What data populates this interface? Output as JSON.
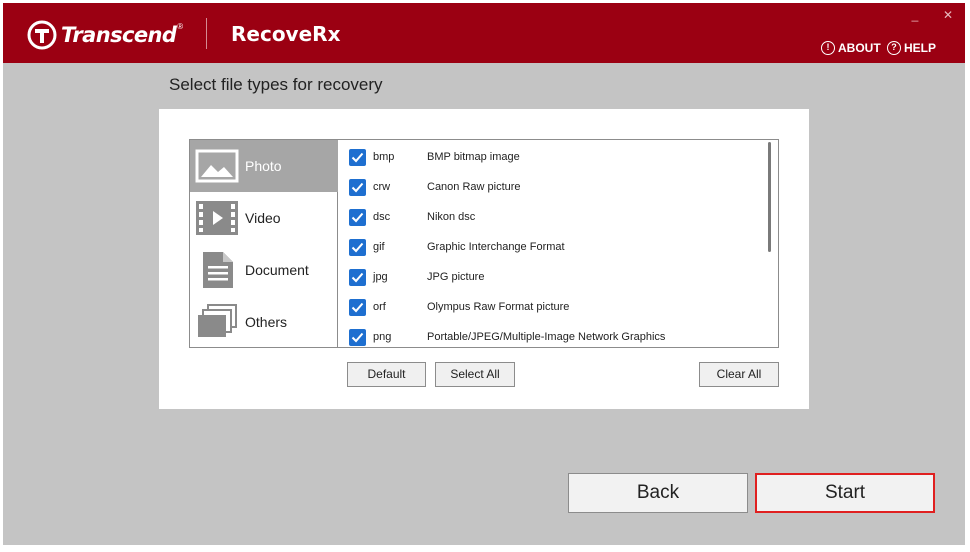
{
  "titlebar": {
    "brand": "Transcend",
    "brand_mark": "®",
    "app_name": "RecoveRx",
    "minimize_glyph": "_",
    "close_glyph": "✕",
    "about_label": "ABOUT",
    "help_label": "HELP",
    "background_color": "#9b0012"
  },
  "main": {
    "heading": "Select file types for recovery"
  },
  "categories": [
    {
      "label": "Photo",
      "icon": "photo-icon",
      "active": true
    },
    {
      "label": "Video",
      "icon": "video-icon",
      "active": false
    },
    {
      "label": "Document",
      "icon": "document-icon",
      "active": false
    },
    {
      "label": "Others",
      "icon": "others-icon",
      "active": false
    }
  ],
  "file_types": [
    {
      "ext": "bmp",
      "desc": "BMP bitmap image",
      "checked": true
    },
    {
      "ext": "crw",
      "desc": "Canon Raw picture",
      "checked": true
    },
    {
      "ext": "dsc",
      "desc": "Nikon dsc",
      "checked": true
    },
    {
      "ext": "gif",
      "desc": "Graphic Interchange Format",
      "checked": true
    },
    {
      "ext": "jpg",
      "desc": "JPG picture",
      "checked": true
    },
    {
      "ext": "orf",
      "desc": "Olympus Raw Format picture",
      "checked": true
    },
    {
      "ext": "png",
      "desc": "Portable/JPEG/Multiple-Image Network Graphics",
      "checked": true
    }
  ],
  "list_buttons": {
    "default": "Default",
    "select_all": "Select All",
    "clear_all": "Clear All"
  },
  "nav_buttons": {
    "back": "Back",
    "start": "Start"
  },
  "colors": {
    "checkbox": "#1e6fd0",
    "start_highlight": "#e02020"
  }
}
